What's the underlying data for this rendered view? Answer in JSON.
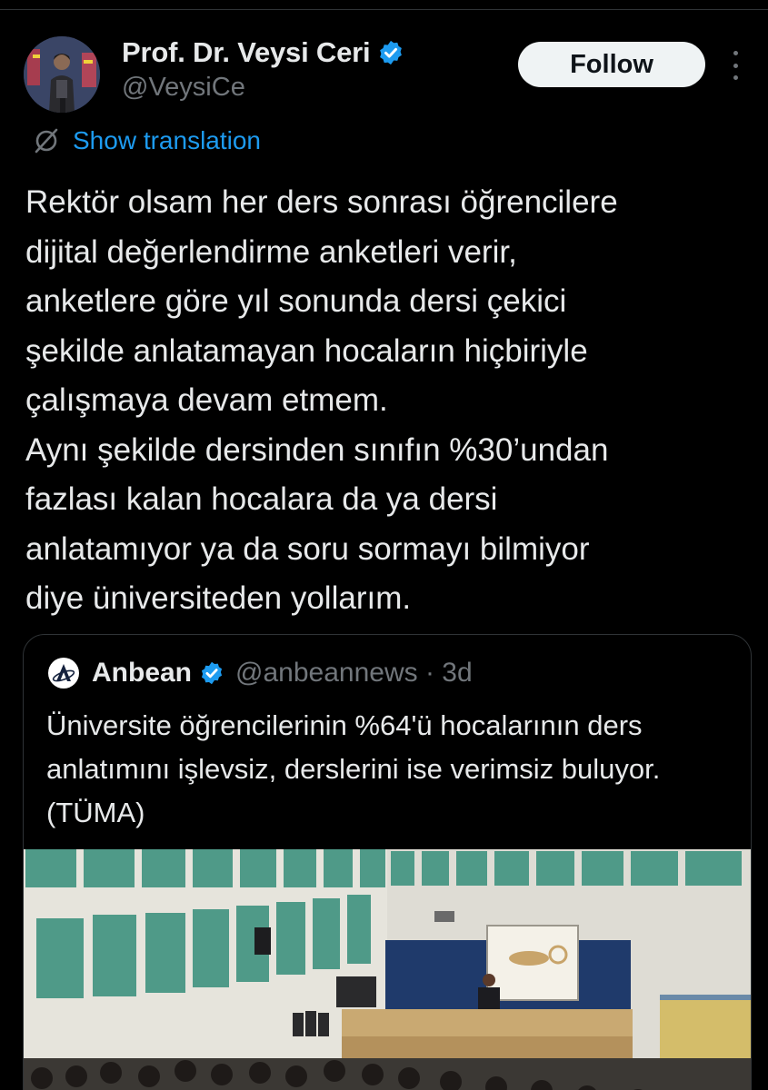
{
  "author": {
    "display_name": "Prof. Dr. Veysi Ceri",
    "handle": "@VeysiCe",
    "verified": true
  },
  "actions": {
    "follow_label": "Follow",
    "more_icon": "more-vertical-icon"
  },
  "translation": {
    "label": "Show translation",
    "icon": "translate-icon"
  },
  "post": {
    "text": "Rektör olsam her ders sonrası öğrencilere\ndijital değerlendirme anketleri verir,\nanketlere göre yıl sonunda dersi çekici\nşekilde anlatamayan hocaların hiçbiriyle\nçalışmaya devam etmem.\nAynı şekilde dersinden sınıfın %30’undan\nfazlası kalan hocalara da ya dersi\nanlatamıyor ya da soru sormayı bilmiyor\ndiye üniversiteden yollarım."
  },
  "quote": {
    "name": "Anbean",
    "handle_time": "@anbeannews · 3d",
    "verified": true,
    "text": "Üniversite öğrencilerinin %64'ü hocalarının ders anlatımını işlevsiz, derslerini ise verimsiz buluyor.  (TÜMA)"
  },
  "colors": {
    "background": "#000000",
    "text": "#e7e9ea",
    "muted": "#71767b",
    "accent": "#1d9bf0",
    "border": "#2f3336"
  }
}
